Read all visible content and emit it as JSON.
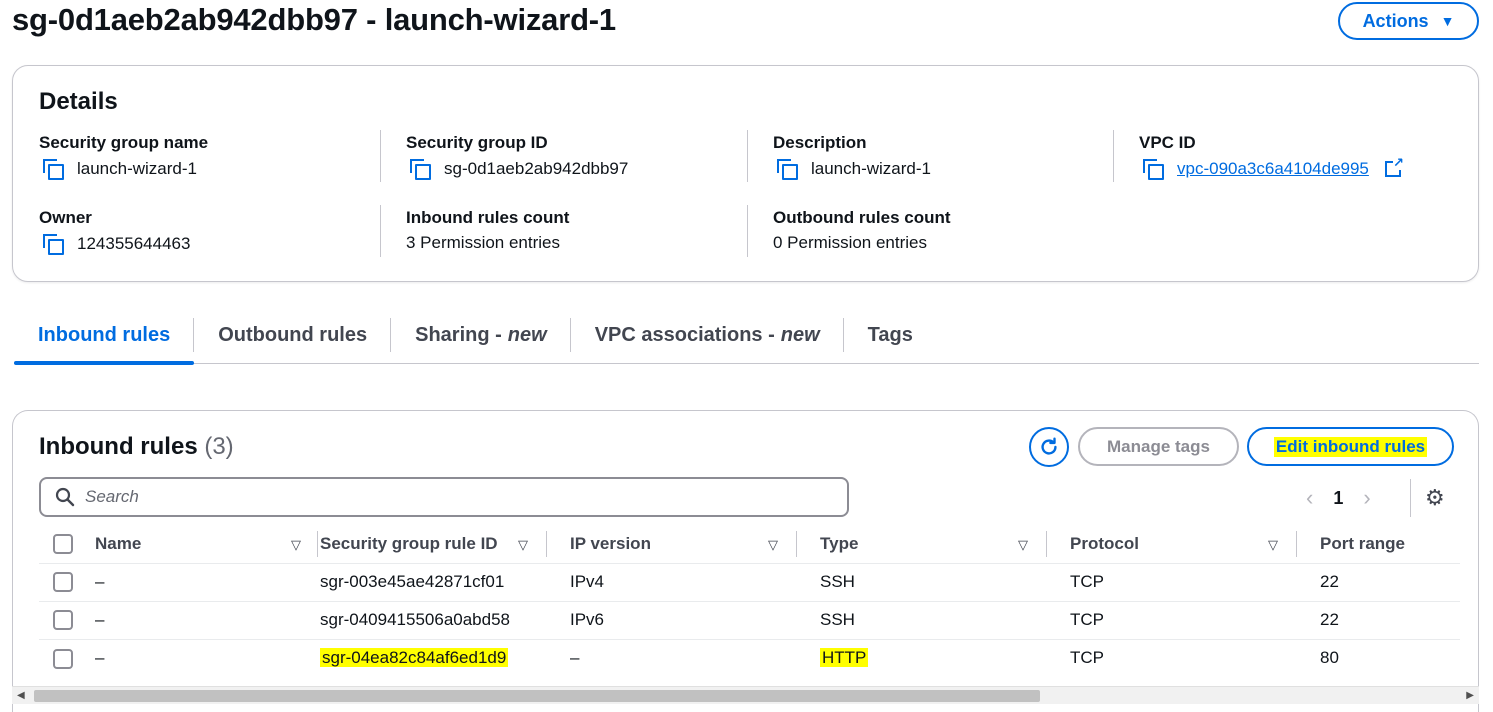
{
  "header": {
    "title": "sg-0d1aeb2ab942dbb97 - launch-wizard-1",
    "actions_label": "Actions"
  },
  "details": {
    "heading": "Details",
    "fields": {
      "sg_name": {
        "label": "Security group name",
        "value": "launch-wizard-1"
      },
      "sg_id": {
        "label": "Security group ID",
        "value": "sg-0d1aeb2ab942dbb97"
      },
      "description": {
        "label": "Description",
        "value": "launch-wizard-1"
      },
      "vpc_id": {
        "label": "VPC ID",
        "value": "vpc-090a3c6a4104de995"
      },
      "owner": {
        "label": "Owner",
        "value": "124355644463"
      },
      "inbound_count": {
        "label": "Inbound rules count",
        "value": "3 Permission entries"
      },
      "outbound_count": {
        "label": "Outbound rules count",
        "value": "0 Permission entries"
      }
    }
  },
  "tabs": [
    {
      "label": "Inbound rules",
      "suffix": "",
      "active": true
    },
    {
      "label": "Outbound rules",
      "suffix": "",
      "active": false
    },
    {
      "label": "Sharing -",
      "suffix": "new",
      "active": false
    },
    {
      "label": "VPC associations -",
      "suffix": "new",
      "active": false
    },
    {
      "label": "Tags",
      "suffix": "",
      "active": false
    }
  ],
  "rules": {
    "heading": "Inbound rules",
    "count": "(3)",
    "manage_tags_label": "Manage tags",
    "edit_label": "Edit inbound rules",
    "search_placeholder": "Search",
    "page": "1",
    "columns": [
      "Name",
      "Security group rule ID",
      "IP version",
      "Type",
      "Protocol",
      "Port range"
    ],
    "rows": [
      {
        "name": "–",
        "rule_id": "sgr-003e45ae42871cf01",
        "ip_version": "IPv4",
        "type": "SSH",
        "protocol": "TCP",
        "port": "22",
        "highlight": false
      },
      {
        "name": "–",
        "rule_id": "sgr-0409415506a0abd58",
        "ip_version": "IPv6",
        "type": "SSH",
        "protocol": "TCP",
        "port": "22",
        "highlight": false
      },
      {
        "name": "–",
        "rule_id": "sgr-04ea82c84af6ed1d9",
        "ip_version": "–",
        "type": "HTTP",
        "protocol": "TCP",
        "port": "80",
        "highlight": true
      }
    ]
  },
  "colors": {
    "accent": "#006ce0",
    "highlight": "#ffff00",
    "border": "#c6c6cd"
  }
}
